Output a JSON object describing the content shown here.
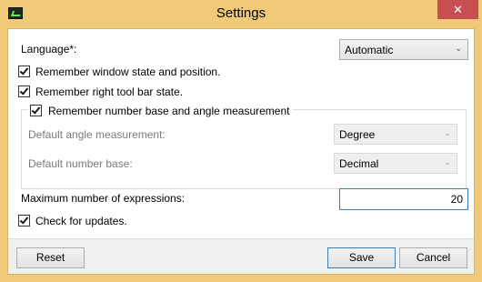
{
  "window": {
    "title": "Settings",
    "close_glyph": "✕",
    "icon": "calculator-app-icon"
  },
  "language": {
    "label": "Language*:",
    "selected": "Automatic"
  },
  "options": {
    "remember_window": {
      "label": "Remember window state and position.",
      "checked": true
    },
    "remember_toolbar": {
      "label": "Remember right tool bar state.",
      "checked": true
    }
  },
  "number_group": {
    "header": "Remember number base and angle measurement",
    "checked": true,
    "angle_label": "Default angle measurement:",
    "angle_value": "Degree",
    "base_label": "Default number base:",
    "base_value": "Decimal"
  },
  "expressions": {
    "label": "Maximum number of expressions:",
    "value": "20"
  },
  "updates": {
    "label": "Check for updates.",
    "checked": true
  },
  "buttons": {
    "reset": "Reset",
    "save": "Save",
    "cancel": "Cancel"
  }
}
